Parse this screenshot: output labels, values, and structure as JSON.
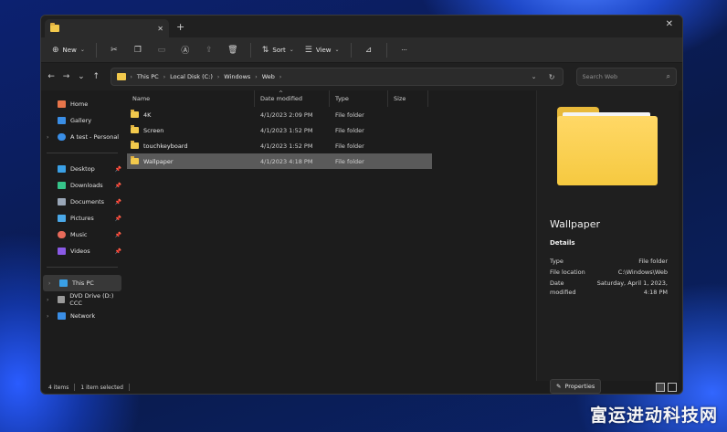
{
  "window": {
    "tab_title": "",
    "close_tab": "✕",
    "new_tab": "+",
    "close_window": "✕"
  },
  "toolbar": {
    "new_label": "New",
    "sort_label": "Sort",
    "view_label": "View",
    "more_label": "···"
  },
  "address": {
    "crumbs": [
      "This PC",
      "Local Disk (C:)",
      "Windows",
      "Web"
    ],
    "search_placeholder": "Search Web"
  },
  "nav": {
    "items": [
      {
        "label": "Home",
        "icon": "home-icon",
        "color": "#e8754a"
      },
      {
        "label": "Gallery",
        "icon": "gallery-icon",
        "color": "#3a8ee6"
      },
      {
        "label": "A test - Personal",
        "icon": "cloud-icon",
        "color": "#3a8ee6"
      },
      {
        "label": "Desktop",
        "icon": "desktop-icon",
        "color": "#3aa0e6"
      },
      {
        "label": "Downloads",
        "icon": "download-icon",
        "color": "#36c48a"
      },
      {
        "label": "Documents",
        "icon": "document-icon",
        "color": "#9aa7b8"
      },
      {
        "label": "Pictures",
        "icon": "pictures-icon",
        "color": "#4aa8e8"
      },
      {
        "label": "Music",
        "icon": "music-icon",
        "color": "#e86a5a"
      },
      {
        "label": "Videos",
        "icon": "videos-icon",
        "color": "#8a5ae6"
      },
      {
        "label": "This PC",
        "icon": "pc-icon",
        "color": "#3aa0e6"
      },
      {
        "label": "DVD Drive (D:) CCC",
        "icon": "dvd-icon",
        "color": "#9a9a9a"
      },
      {
        "label": "Network",
        "icon": "network-icon",
        "color": "#3a8ee6"
      }
    ]
  },
  "columns": {
    "name": "Name",
    "date": "Date modified",
    "type": "Type",
    "size": "Size"
  },
  "files": [
    {
      "name": "4K",
      "date": "4/1/2023 2:09 PM",
      "type": "File folder"
    },
    {
      "name": "Screen",
      "date": "4/1/2023 1:52 PM",
      "type": "File folder"
    },
    {
      "name": "touchkeyboard",
      "date": "4/1/2023 1:52 PM",
      "type": "File folder"
    },
    {
      "name": "Wallpaper",
      "date": "4/1/2023 4:18 PM",
      "type": "File folder"
    }
  ],
  "details": {
    "title": "Wallpaper",
    "heading": "Details",
    "rows": [
      {
        "label": "Type",
        "value": "File folder"
      },
      {
        "label": "File location",
        "value": "C:\\Windows\\Web"
      },
      {
        "label": "Date",
        "value": "Saturday, April 1, 2023,"
      },
      {
        "label": "modified",
        "value": "4:18 PM"
      }
    ],
    "properties_label": "Properties"
  },
  "status": {
    "items_count": "4 items",
    "selected_count": "1 item selected"
  },
  "watermark": "富运进动科技网",
  "colors": {
    "accent_folder": "#f2c94c",
    "selection": "#5a5a5a",
    "window_bg": "#1c1c1c"
  }
}
